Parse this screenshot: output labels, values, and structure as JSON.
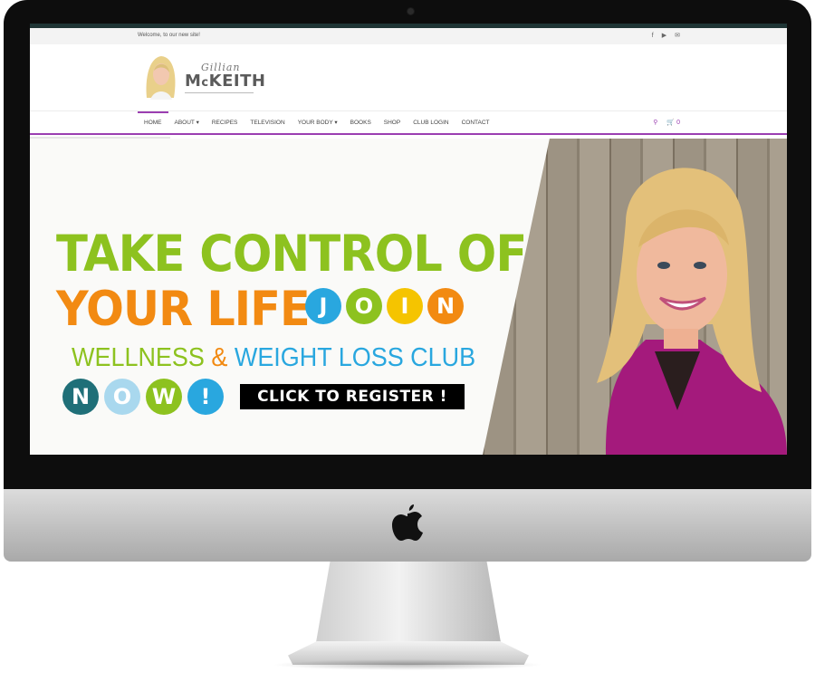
{
  "topbar": {
    "welcome": "Welcome, to our new site!"
  },
  "social": [
    {
      "icon": "facebook-icon",
      "glyph": "f"
    },
    {
      "icon": "youtube-icon",
      "glyph": "▶"
    },
    {
      "icon": "email-icon",
      "glyph": "✉"
    }
  ],
  "logo": {
    "line1": "Gillian",
    "line2_prefix": "M",
    "line2_small": "c",
    "line2_rest": "KEITH"
  },
  "nav": {
    "items": [
      {
        "label": "HOME",
        "active": true
      },
      {
        "label": "ABOUT ▾"
      },
      {
        "label": "RECIPES"
      },
      {
        "label": "TELEVISION"
      },
      {
        "label": "YOUR BODY ▾"
      },
      {
        "label": "BOOKS"
      },
      {
        "label": "SHOP"
      },
      {
        "label": "CLUB LOGIN"
      },
      {
        "label": "CONTACT"
      }
    ],
    "search_icon": "⚲",
    "cart_icon": "🛒",
    "cart_count": "0"
  },
  "hero": {
    "headline1": "TAKE CONTROL OF",
    "headline2": "YOUR LIFE",
    "join_letters": [
      "J",
      "O",
      "I",
      "N"
    ],
    "subheadline_a": "WELLNESS ",
    "subheadline_amp": "&",
    "subheadline_b": " WEIGHT LOSS CLUB",
    "now_letters": [
      "N",
      "O",
      "W",
      "!"
    ],
    "cta": "CLICK TO REGISTER !"
  },
  "colors": {
    "accent": "#9b3fb1",
    "green": "#8dc21f",
    "orange": "#f28a12",
    "blue": "#29a7df",
    "teal": "#1f6f78",
    "yellow": "#f5c400",
    "light_blue": "#a9d8ee"
  }
}
